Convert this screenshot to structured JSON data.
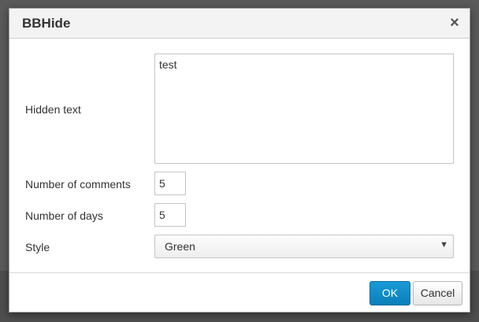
{
  "dialog": {
    "title": "BBHide",
    "close_symbol": "×"
  },
  "form": {
    "hidden_text_label": "Hidden text",
    "hidden_text_value": "test",
    "comments_label": "Number of comments",
    "comments_value": "5",
    "days_label": "Number of days",
    "days_value": "5",
    "style_label": "Style",
    "style_value": "Green",
    "style_caret": "▼"
  },
  "footer": {
    "ok_label": "OK",
    "cancel_label": "Cancel"
  },
  "colors": {
    "primary_button": "#0a7fb8",
    "backdrop": "#5a5a5a"
  }
}
